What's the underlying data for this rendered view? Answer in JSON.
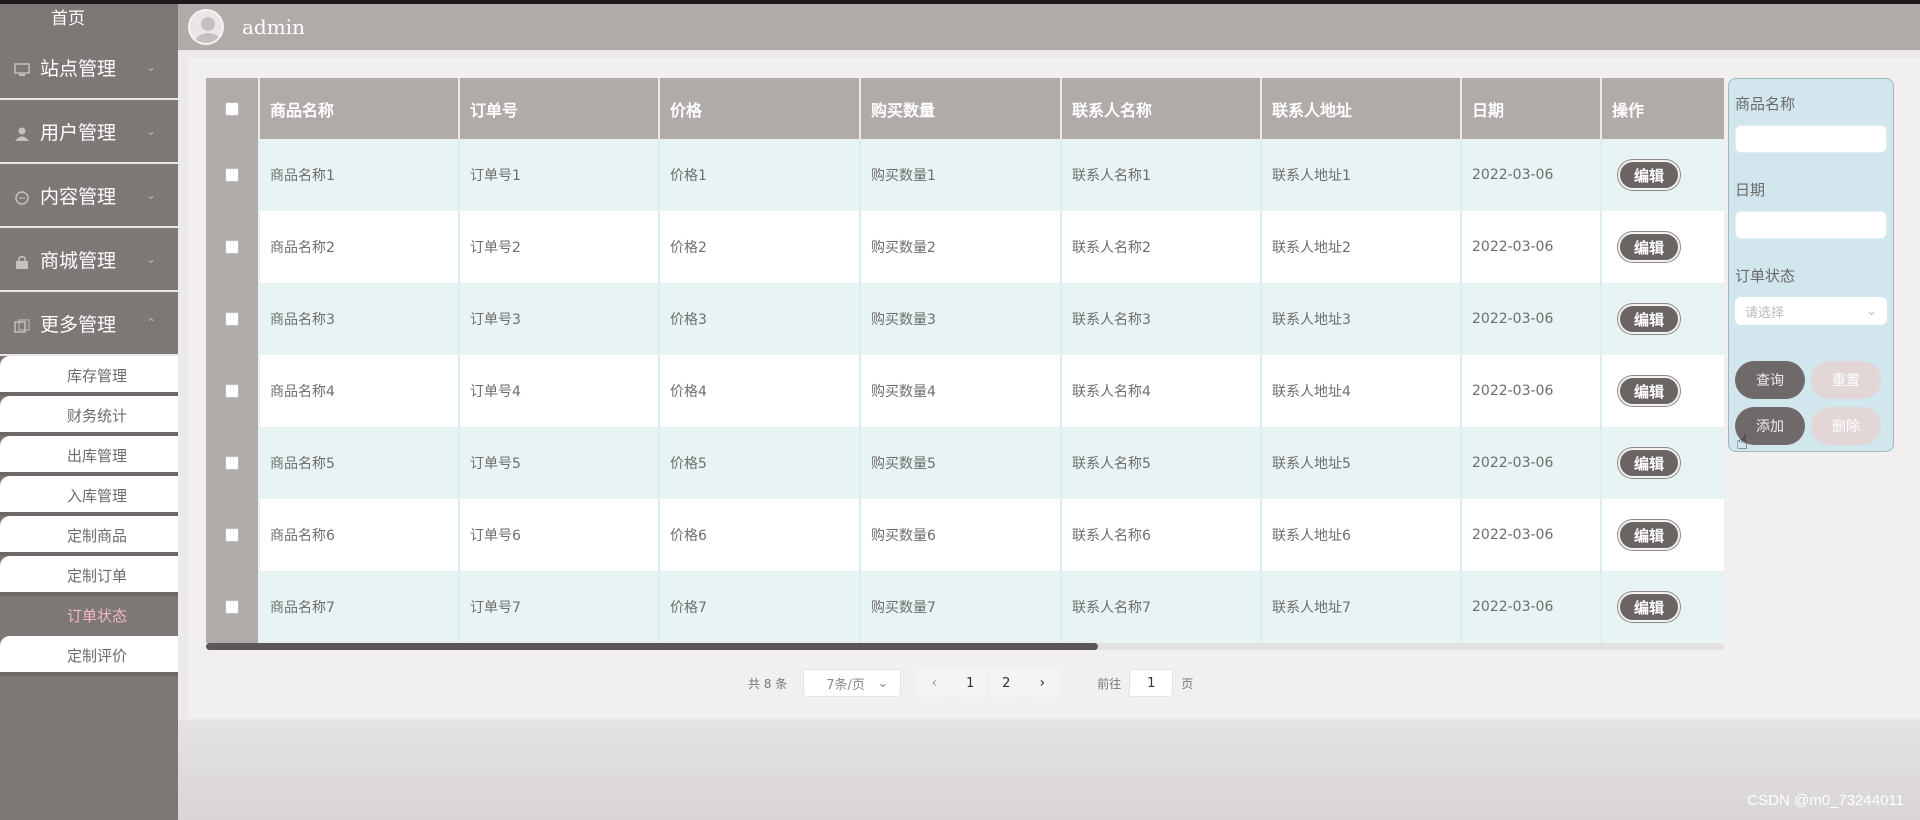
{
  "header": {
    "username": "admin"
  },
  "sidebar": {
    "home": "首页",
    "menus": [
      {
        "label": "站点管理"
      },
      {
        "label": "用户管理"
      },
      {
        "label": "内容管理"
      },
      {
        "label": "商城管理"
      },
      {
        "label": "更多管理"
      }
    ],
    "submenu": [
      {
        "label": "库存管理"
      },
      {
        "label": "财务统计"
      },
      {
        "label": "出库管理"
      },
      {
        "label": "入库管理"
      },
      {
        "label": "定制商品"
      },
      {
        "label": "定制订单"
      },
      {
        "label": "订单状态"
      },
      {
        "label": "定制评价"
      }
    ]
  },
  "table": {
    "headers": [
      "商品名称",
      "订单号",
      "价格",
      "购买数量",
      "联系人名称",
      "联系人地址",
      "日期",
      "操作"
    ],
    "edit_label": "编辑",
    "rows": [
      {
        "name": "商品名称1",
        "order": "订单号1",
        "price": "价格1",
        "qty": "购买数量1",
        "contact": "联系人名称1",
        "addr": "联系人地址1",
        "date": "2022-03-06"
      },
      {
        "name": "商品名称2",
        "order": "订单号2",
        "price": "价格2",
        "qty": "购买数量2",
        "contact": "联系人名称2",
        "addr": "联系人地址2",
        "date": "2022-03-06"
      },
      {
        "name": "商品名称3",
        "order": "订单号3",
        "price": "价格3",
        "qty": "购买数量3",
        "contact": "联系人名称3",
        "addr": "联系人地址3",
        "date": "2022-03-06"
      },
      {
        "name": "商品名称4",
        "order": "订单号4",
        "price": "价格4",
        "qty": "购买数量4",
        "contact": "联系人名称4",
        "addr": "联系人地址4",
        "date": "2022-03-06"
      },
      {
        "name": "商品名称5",
        "order": "订单号5",
        "price": "价格5",
        "qty": "购买数量5",
        "contact": "联系人名称5",
        "addr": "联系人地址5",
        "date": "2022-03-06"
      },
      {
        "name": "商品名称6",
        "order": "订单号6",
        "price": "价格6",
        "qty": "购买数量6",
        "contact": "联系人名称6",
        "addr": "联系人地址6",
        "date": "2022-03-06"
      },
      {
        "name": "商品名称7",
        "order": "订单号7",
        "price": "价格7",
        "qty": "购买数量7",
        "contact": "联系人名称7",
        "addr": "联系人地址7",
        "date": "2022-03-06"
      }
    ]
  },
  "search": {
    "name_label": "商品名称",
    "date_label": "日期",
    "status_label": "订单状态",
    "status_placeholder": "请选择",
    "query": "查询",
    "reset": "重置",
    "add": "添加",
    "delete": "删除"
  },
  "pager": {
    "total": "共 8 条",
    "page_size": "7条/页",
    "pages": [
      "1",
      "2"
    ],
    "goto_prefix": "前往",
    "goto_value": "1",
    "goto_suffix": "页"
  },
  "watermark": "CSDN @m0_73244011",
  "colors": {
    "sidebar": "#7d7776",
    "header": "#b0aaa8",
    "button_dark": "#6a6462",
    "row_alt": "#e8f3f3",
    "active_sub": "#f2b8c4"
  }
}
